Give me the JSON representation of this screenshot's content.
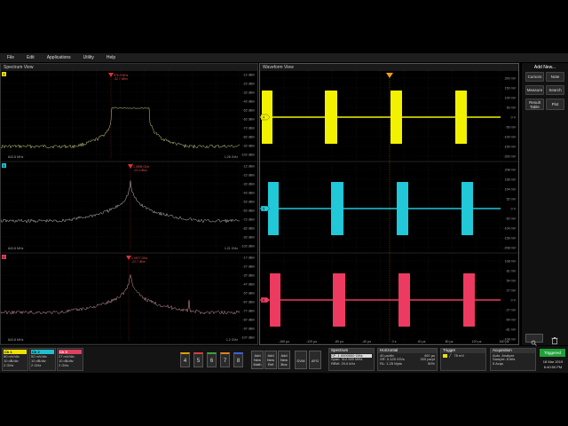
{
  "menu": [
    "File",
    "Edit",
    "Applications",
    "Utility",
    "Help"
  ],
  "spectrum": {
    "title": "Spectrum View",
    "panes": [
      {
        "tag": "4",
        "color": "#e8e000",
        "trace": "#d6d68a",
        "ref_tick": "-12 dBm",
        "ticks": [
          "-12 dBm",
          "-22 dBm",
          "-32 dBm",
          "-42 dBm",
          "-52 dBm",
          "-62 dBm",
          "-72 dBm",
          "-82 dBm",
          "-92 dBm",
          "-102 dBm"
        ],
        "start": "843.8 MHz",
        "stop": "1.26 GHz",
        "marker_label": "976.3 MHz\n-32.7 dBm"
      },
      {
        "tag": "5",
        "color": "#20c0d0",
        "trace": "#c9c9c9",
        "ref_tick": "-12 dBm",
        "ticks": [
          "-12 dBm",
          "-22 dBm",
          "-32 dBm",
          "-42 dBm",
          "-52 dBm",
          "-62 dBm",
          "-72 dBm",
          "-82 dBm",
          "-92 dBm",
          "-102 dBm"
        ],
        "start": "843.8 MHz",
        "stop": "1.21 GHz",
        "marker_label": "1.0598 GHz\n-13.4 dBm"
      },
      {
        "tag": "6",
        "color": "#e04060",
        "trace": "#d8a0a8",
        "ref_tick": "-17 dBm",
        "ticks": [
          "-17 dBm",
          "-27 dBm",
          "-37 dBm",
          "-47 dBm",
          "-57 dBm",
          "-67 dBm",
          "-77 dBm",
          "-87 dBm",
          "-97 dBm",
          "-107 dBm"
        ],
        "start": "843.8 MHz",
        "stop": "1.2 GHz",
        "marker_label": "1.0577 GHz\n-22.7 dBm"
      }
    ]
  },
  "waveform": {
    "title": "Waveform View",
    "panes": [
      {
        "tag": "4",
        "color": "#f2f200",
        "ticks": [
          "200 mV",
          "150 mV",
          "100 mV",
          "50 mV",
          "0 V",
          "-50 mV",
          "-100 mV",
          "-150 mV",
          "-200 mV"
        ]
      },
      {
        "tag": "5",
        "color": "#20c8d8",
        "ticks": [
          "208 mV",
          "156 mV",
          "104 mV",
          "52 mV",
          "0 V",
          "-52 mV",
          "-104 mV",
          "-156 mV",
          "-208 mV"
        ]
      },
      {
        "tag": "6",
        "color": "#ec3a60",
        "ticks": [
          "108 mV",
          "81 mV",
          "54 mV",
          "27 mV",
          "0 V",
          "-27 mV",
          "-54 mV",
          "-81 mV",
          "-108 mV"
        ]
      }
    ],
    "time_ticks": [
      "-160 µs",
      "-120 µs",
      "-80 µs",
      "-40 µs",
      "0 s",
      "40 µs",
      "80 µs",
      "120 µs",
      "160 µs"
    ]
  },
  "sidebar": {
    "title": "Add New...",
    "buttons": [
      "Cursors",
      "Note",
      "Measure",
      "Search",
      "Result Table",
      "Plot"
    ]
  },
  "channels": [
    {
      "name": "Ch 1",
      "color": "#f0e000",
      "lines": [
        "50 mV/div",
        "10 dB/div",
        "2 GHz"
      ]
    },
    {
      "name": "Ch 2",
      "color": "#20c0d0",
      "lines": [
        "52 mV/div",
        "10 dB/div",
        "2 GHz"
      ]
    },
    {
      "name": "Ch 3",
      "color": "#e04060",
      "lines": [
        "27 mV/div",
        "10 dB/div",
        "2 GHz"
      ]
    }
  ],
  "channel_numbers": [
    "4",
    "5",
    "6",
    "7",
    "8"
  ],
  "toolbar": [
    {
      "key": "add_math",
      "lines": [
        "Add",
        "New",
        "Math"
      ]
    },
    {
      "key": "add_ref",
      "lines": [
        "Add",
        "New",
        "Ref"
      ]
    },
    {
      "key": "add_bus",
      "lines": [
        "Add",
        "New",
        "Bus"
      ]
    }
  ],
  "dvm": "DVM",
  "afg": "AFG",
  "spectrum_info": {
    "title": "Spectrum",
    "lines": [
      "CF: 1.0000000 GHz",
      "Span: 312.500 MHz",
      "RBW: 20.0 kHz"
    ]
  },
  "horizontal": {
    "title": "Horizontal",
    "lines": [
      "40 µs/div",
      "SR: 3.125 GS/s",
      "RL: 1.25 Mpts"
    ],
    "extra": [
      "400 µs",
      "320 ps/pt",
      "50%"
    ]
  },
  "trigger": {
    "title": "Trigger",
    "lines": [
      "78 mV"
    ]
  },
  "acquisition": {
    "title": "Acquisition",
    "lines": [
      "Auto,    Analyze",
      "Sample: 8 bits",
      "5 Acqs"
    ]
  },
  "status": {
    "triggered": "Triggered",
    "date": "18 Mar 2019",
    "time": "6:40:50 PM"
  }
}
